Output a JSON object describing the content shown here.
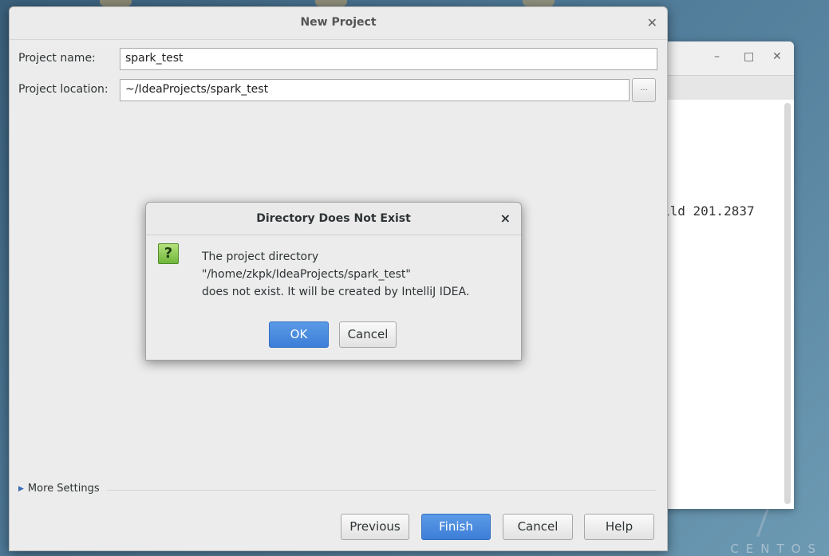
{
  "desktop": {
    "watermark": "CENTOS"
  },
  "bg_window": {
    "minimize_glyph": "–",
    "maximize_glyph": "□",
    "close_glyph": "✕",
    "text": "ild 201.2837"
  },
  "dialog": {
    "title": "New Project",
    "close_glyph": "✕",
    "project_name_label": "Project name:",
    "project_name_value": "spark_test",
    "project_location_label": "Project location:",
    "project_location_value": "~/IdeaProjects/spark_test",
    "browse_label": "...",
    "more_settings_label": "More Settings",
    "buttons": {
      "previous": "Previous",
      "finish": "Finish",
      "cancel": "Cancel",
      "help": "Help"
    }
  },
  "modal": {
    "title": "Directory Does Not Exist",
    "close_glyph": "×",
    "icon_glyph": "?",
    "icon_name": "question-icon",
    "message_line1": "The project directory",
    "message_line2": "\"/home/zkpk/IdeaProjects/spark_test\"",
    "message_line3": "does not exist. It will be created by IntelliJ IDEA.",
    "ok_label": "OK",
    "cancel_label": "Cancel"
  },
  "colors": {
    "primary_button": "#3d7ed8",
    "question_icon": "#6fb63a"
  }
}
